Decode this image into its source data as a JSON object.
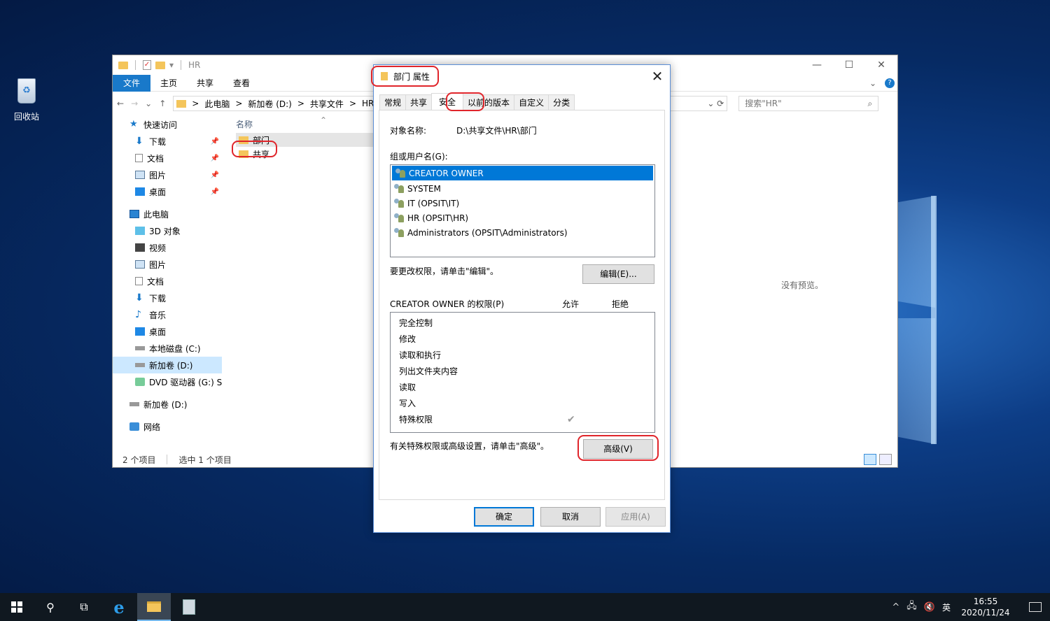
{
  "desktop": {
    "recycle_bin_label": "回收站"
  },
  "explorer": {
    "title": "HR",
    "ribbon_tabs": [
      "文件",
      "主页",
      "共享",
      "查看"
    ],
    "breadcrumb": [
      "此电脑",
      "新加卷 (D:)",
      "共享文件",
      "HR"
    ],
    "breadcrumb_sep": ">",
    "search_placeholder": "搜索\"HR\"",
    "nav": {
      "quick_access": "快速访问",
      "quick_items": [
        "下载",
        "文档",
        "图片",
        "桌面"
      ],
      "this_pc": "此电脑",
      "pc_items": [
        "3D 对象",
        "视频",
        "图片",
        "文档",
        "下载",
        "音乐",
        "桌面",
        "本地磁盘 (C:)",
        "新加卷 (D:)",
        "DVD 驱动器 (G:) SS"
      ],
      "drive_d": "新加卷 (D:)",
      "network": "网络"
    },
    "column_name": "名称",
    "files": [
      "部门",
      "共享"
    ],
    "status_count": "2 个项目",
    "status_selected": "选中 1 个项目",
    "preview_text": "没有预览。"
  },
  "dialog": {
    "title": "部门 属性",
    "tabs": [
      "常规",
      "共享",
      "安全",
      "以前的版本",
      "自定义",
      "分类"
    ],
    "object_name_label": "对象名称:",
    "object_name_value": "D:\\共享文件\\HR\\部门",
    "group_label": "组或用户名(G):",
    "users": [
      "CREATOR OWNER",
      "SYSTEM",
      "IT (OPSIT\\IT)",
      "HR (OPSIT\\HR)",
      "Administrators (OPSIT\\Administrators)"
    ],
    "change_hint": "要更改权限，请单击\"编辑\"。",
    "edit_button": "编辑(E)...",
    "perm_label": "CREATOR OWNER 的权限(P)",
    "allow_label": "允许",
    "deny_label": "拒绝",
    "permissions": [
      "完全控制",
      "修改",
      "读取和执行",
      "列出文件夹内容",
      "读取",
      "写入",
      "特殊权限"
    ],
    "special_hint": "有关特殊权限或高级设置，请单击\"高级\"。",
    "advanced_button": "高级(V)",
    "ok_button": "确定",
    "cancel_button": "取消",
    "apply_button": "应用(A)"
  },
  "taskbar": {
    "input_method": "英",
    "time": "16:55",
    "date": "2020/11/24"
  },
  "colors": {
    "accent": "#0078d7",
    "highlight_mark": "#e0252b",
    "folder": "#f4c55b"
  }
}
